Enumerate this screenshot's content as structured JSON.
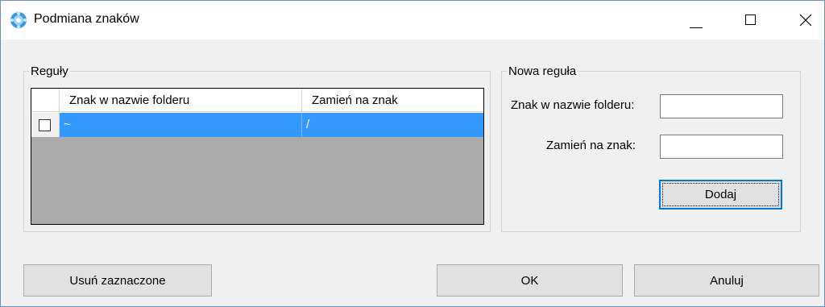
{
  "window": {
    "title": "Podmiana znaków"
  },
  "rules": {
    "group_label": "Reguły",
    "columns": [
      "Znak w nazwie folderu",
      "Zamień na znak"
    ],
    "rows": [
      {
        "checked": false,
        "from": "~",
        "to": "/",
        "selected": true
      }
    ]
  },
  "new_rule": {
    "group_label": "Nowa reguła",
    "char_label": "Znak w nazwie folderu:",
    "char_value": "",
    "replace_label": "Zamień na znak:",
    "replace_value": "",
    "add_button": "Dodaj"
  },
  "footer": {
    "remove_button": "Usuń zaznaczone",
    "ok_button": "OK",
    "cancel_button": "Anuluj"
  },
  "colors": {
    "selection": "#3399ff",
    "grid_background": "#ababab",
    "focus_border": "#0078d7"
  }
}
